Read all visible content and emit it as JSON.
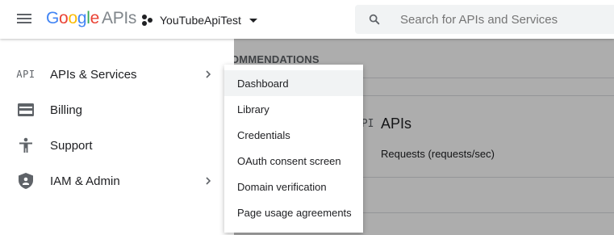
{
  "header": {
    "logo_google": [
      "G",
      "o",
      "o",
      "g",
      "l",
      "e"
    ],
    "logo_suffix": "APIs",
    "project_name": "YouTubeApiTest",
    "search_placeholder": "Search for APIs and Services"
  },
  "background": {
    "section_heading": "OMMENDATIONS",
    "apis_icon_text": "API",
    "apis_title": "APIs",
    "requests_label": "Requests (requests/sec)"
  },
  "sidebar": {
    "items": [
      {
        "icon": "api-icon",
        "icon_text": "API",
        "label": "APIs & Services",
        "has_submenu": true
      },
      {
        "icon": "billing-icon",
        "label": "Billing",
        "has_submenu": false
      },
      {
        "icon": "support-icon",
        "label": "Support",
        "has_submenu": false
      },
      {
        "icon": "iam-shield-icon",
        "label": "IAM & Admin",
        "has_submenu": true
      }
    ]
  },
  "submenu": {
    "items": [
      {
        "label": "Dashboard",
        "active": true
      },
      {
        "label": "Library"
      },
      {
        "label": "Credentials"
      },
      {
        "label": "OAuth consent screen"
      },
      {
        "label": "Domain verification"
      },
      {
        "label": "Page usage agreements"
      }
    ]
  },
  "colors": {
    "google_blue": "#4285f4",
    "google_red": "#ea4335",
    "google_yellow": "#fbbc05",
    "google_green": "#34a853",
    "icon_grey": "#5f6368",
    "active_bg": "#f1f3f4"
  }
}
